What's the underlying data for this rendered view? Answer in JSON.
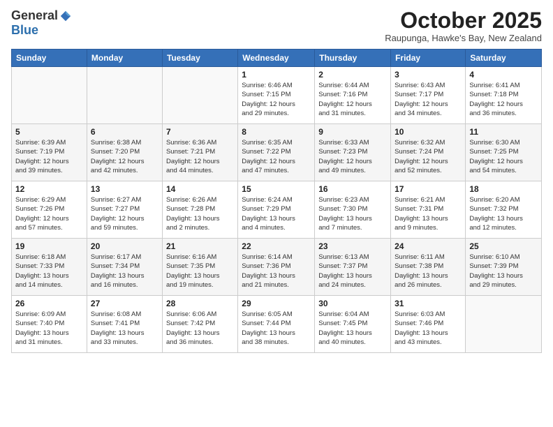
{
  "logo": {
    "general": "General",
    "blue": "Blue"
  },
  "header": {
    "month": "October 2025",
    "location": "Raupunga, Hawke's Bay, New Zealand"
  },
  "weekdays": [
    "Sunday",
    "Monday",
    "Tuesday",
    "Wednesday",
    "Thursday",
    "Friday",
    "Saturday"
  ],
  "weeks": [
    [
      {
        "num": "",
        "info": ""
      },
      {
        "num": "",
        "info": ""
      },
      {
        "num": "",
        "info": ""
      },
      {
        "num": "1",
        "info": "Sunrise: 6:46 AM\nSunset: 7:15 PM\nDaylight: 12 hours\nand 29 minutes."
      },
      {
        "num": "2",
        "info": "Sunrise: 6:44 AM\nSunset: 7:16 PM\nDaylight: 12 hours\nand 31 minutes."
      },
      {
        "num": "3",
        "info": "Sunrise: 6:43 AM\nSunset: 7:17 PM\nDaylight: 12 hours\nand 34 minutes."
      },
      {
        "num": "4",
        "info": "Sunrise: 6:41 AM\nSunset: 7:18 PM\nDaylight: 12 hours\nand 36 minutes."
      }
    ],
    [
      {
        "num": "5",
        "info": "Sunrise: 6:39 AM\nSunset: 7:19 PM\nDaylight: 12 hours\nand 39 minutes."
      },
      {
        "num": "6",
        "info": "Sunrise: 6:38 AM\nSunset: 7:20 PM\nDaylight: 12 hours\nand 42 minutes."
      },
      {
        "num": "7",
        "info": "Sunrise: 6:36 AM\nSunset: 7:21 PM\nDaylight: 12 hours\nand 44 minutes."
      },
      {
        "num": "8",
        "info": "Sunrise: 6:35 AM\nSunset: 7:22 PM\nDaylight: 12 hours\nand 47 minutes."
      },
      {
        "num": "9",
        "info": "Sunrise: 6:33 AM\nSunset: 7:23 PM\nDaylight: 12 hours\nand 49 minutes."
      },
      {
        "num": "10",
        "info": "Sunrise: 6:32 AM\nSunset: 7:24 PM\nDaylight: 12 hours\nand 52 minutes."
      },
      {
        "num": "11",
        "info": "Sunrise: 6:30 AM\nSunset: 7:25 PM\nDaylight: 12 hours\nand 54 minutes."
      }
    ],
    [
      {
        "num": "12",
        "info": "Sunrise: 6:29 AM\nSunset: 7:26 PM\nDaylight: 12 hours\nand 57 minutes."
      },
      {
        "num": "13",
        "info": "Sunrise: 6:27 AM\nSunset: 7:27 PM\nDaylight: 12 hours\nand 59 minutes."
      },
      {
        "num": "14",
        "info": "Sunrise: 6:26 AM\nSunset: 7:28 PM\nDaylight: 13 hours\nand 2 minutes."
      },
      {
        "num": "15",
        "info": "Sunrise: 6:24 AM\nSunset: 7:29 PM\nDaylight: 13 hours\nand 4 minutes."
      },
      {
        "num": "16",
        "info": "Sunrise: 6:23 AM\nSunset: 7:30 PM\nDaylight: 13 hours\nand 7 minutes."
      },
      {
        "num": "17",
        "info": "Sunrise: 6:21 AM\nSunset: 7:31 PM\nDaylight: 13 hours\nand 9 minutes."
      },
      {
        "num": "18",
        "info": "Sunrise: 6:20 AM\nSunset: 7:32 PM\nDaylight: 13 hours\nand 12 minutes."
      }
    ],
    [
      {
        "num": "19",
        "info": "Sunrise: 6:18 AM\nSunset: 7:33 PM\nDaylight: 13 hours\nand 14 minutes."
      },
      {
        "num": "20",
        "info": "Sunrise: 6:17 AM\nSunset: 7:34 PM\nDaylight: 13 hours\nand 16 minutes."
      },
      {
        "num": "21",
        "info": "Sunrise: 6:16 AM\nSunset: 7:35 PM\nDaylight: 13 hours\nand 19 minutes."
      },
      {
        "num": "22",
        "info": "Sunrise: 6:14 AM\nSunset: 7:36 PM\nDaylight: 13 hours\nand 21 minutes."
      },
      {
        "num": "23",
        "info": "Sunrise: 6:13 AM\nSunset: 7:37 PM\nDaylight: 13 hours\nand 24 minutes."
      },
      {
        "num": "24",
        "info": "Sunrise: 6:11 AM\nSunset: 7:38 PM\nDaylight: 13 hours\nand 26 minutes."
      },
      {
        "num": "25",
        "info": "Sunrise: 6:10 AM\nSunset: 7:39 PM\nDaylight: 13 hours\nand 29 minutes."
      }
    ],
    [
      {
        "num": "26",
        "info": "Sunrise: 6:09 AM\nSunset: 7:40 PM\nDaylight: 13 hours\nand 31 minutes."
      },
      {
        "num": "27",
        "info": "Sunrise: 6:08 AM\nSunset: 7:41 PM\nDaylight: 13 hours\nand 33 minutes."
      },
      {
        "num": "28",
        "info": "Sunrise: 6:06 AM\nSunset: 7:42 PM\nDaylight: 13 hours\nand 36 minutes."
      },
      {
        "num": "29",
        "info": "Sunrise: 6:05 AM\nSunset: 7:44 PM\nDaylight: 13 hours\nand 38 minutes."
      },
      {
        "num": "30",
        "info": "Sunrise: 6:04 AM\nSunset: 7:45 PM\nDaylight: 13 hours\nand 40 minutes."
      },
      {
        "num": "31",
        "info": "Sunrise: 6:03 AM\nSunset: 7:46 PM\nDaylight: 13 hours\nand 43 minutes."
      },
      {
        "num": "",
        "info": ""
      }
    ]
  ]
}
